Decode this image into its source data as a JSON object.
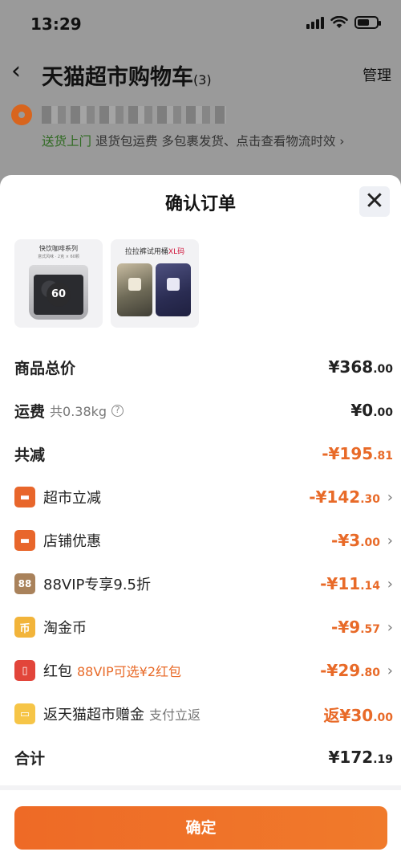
{
  "status_bar": {
    "time": "13:29"
  },
  "cart": {
    "title": "天猫超市购物车",
    "count": "(3)",
    "manage_label": "管理",
    "delivery_highlight": "送货上门",
    "delivery_text": " 退货包运费 多包裹发货、点击查看物流时效 ›"
  },
  "sheet": {
    "title": "确认订单",
    "close_icon": "✕",
    "products": [
      {
        "caption": "快饮咖啡系列",
        "sub": "意式风味 · 2克 × 60颗",
        "badge": "60"
      },
      {
        "caption": "拉拉裤试用桶",
        "caption_highlight": "XL码"
      }
    ],
    "rows": [
      {
        "label": "商品总价",
        "value": "¥368",
        "decimals": ".00",
        "style": "total"
      },
      {
        "label": "运费",
        "sub": "共0.38kg",
        "info_icon": "?",
        "value": "¥0",
        "decimals": ".00",
        "style": "total"
      },
      {
        "label": "共减",
        "value": "-¥195",
        "decimals": ".81",
        "style": "discount-total"
      },
      {
        "icon": "store-icon",
        "icon_text": "▬",
        "label": "超市立减",
        "value": "-¥142",
        "decimals": ".30",
        "style": "discount"
      },
      {
        "icon": "shop-icon",
        "icon_text": "▬",
        "label": "店铺优惠",
        "value": "-¥3",
        "decimals": ".00",
        "style": "discount"
      },
      {
        "icon": "vip-icon",
        "icon_text": "88",
        "label": "88VIP专享9.5折",
        "value": "-¥11",
        "decimals": ".14",
        "style": "discount"
      },
      {
        "icon": "coin-icon",
        "icon_text": "币",
        "label": "淘金币",
        "value": "-¥9",
        "decimals": ".57",
        "style": "discount"
      },
      {
        "icon": "red-packet-icon",
        "icon_text": "▯",
        "label": "红包",
        "sub": "88VIP可选¥2红包",
        "value": "-¥29",
        "decimals": ".80",
        "style": "discount"
      },
      {
        "icon": "gift-card-icon",
        "icon_text": "▭",
        "label": "返天猫超市赠金",
        "sub": "支付立返",
        "value": "返¥30",
        "decimals": ".00",
        "style": "rebate"
      },
      {
        "label": "合计",
        "value": "¥172",
        "decimals": ".19",
        "style": "total"
      }
    ],
    "confirm_label": "确定"
  },
  "colors": {
    "accent": "#e86a28",
    "button": "#ee6a26",
    "green": "#2f6a21"
  }
}
